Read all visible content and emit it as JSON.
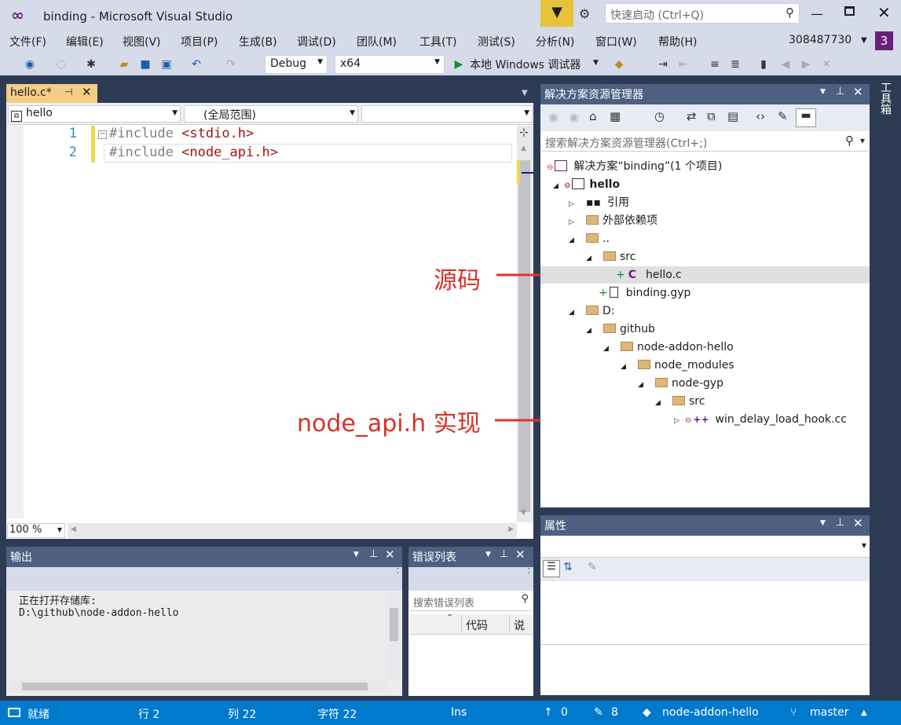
{
  "window": {
    "title": "binding - Microsoft Visual Studio",
    "quick_launch_placeholder": "快速启动 (Ctrl+Q)",
    "account": "308487730",
    "notif": "3"
  },
  "menu": [
    "文件(F)",
    "编辑(E)",
    "视图(V)",
    "项目(P)",
    "生成(B)",
    "调试(D)",
    "团队(M)",
    "工具(T)",
    "测试(S)",
    "分析(N)",
    "窗口(W)",
    "帮助(H)"
  ],
  "toolbar": {
    "config": "Debug",
    "platform": "x64",
    "run_label": "本地 Windows 调试器"
  },
  "editor": {
    "tab": "hello.c*",
    "scope_left": "hello",
    "scope_mid": "(全局范围)",
    "zoom": "100 %",
    "lines": [
      {
        "num": "1",
        "directive": "#include",
        "target": "<stdio.h>"
      },
      {
        "num": "2",
        "directive": "#include",
        "target": "<node_api.h>"
      }
    ]
  },
  "solution": {
    "title": "解决方案资源管理器",
    "search": "搜索解决方案资源管理器(Ctrl+;)",
    "solution_label": "解决方案“binding”(1 个项目)",
    "project": "hello",
    "items": {
      "refs": "引用",
      "extdeps": "外部依赖项",
      "dotdot": "..",
      "src": "src",
      "hello_c": "hello.c",
      "binding_gyp": "binding.gyp",
      "d": "D:",
      "github": "github",
      "addon": "node-addon-hello",
      "node_modules": "node_modules",
      "node_gyp": "node-gyp",
      "src2": "src",
      "hook": "win_delay_load_hook.cc"
    }
  },
  "annotations": {
    "source": "源码",
    "impl": "node_api.h 实现"
  },
  "properties": {
    "title": "属性"
  },
  "output": {
    "title": "输出",
    "line1": "正在打开存储库:",
    "line2": "D:\\github\\node-addon-hello"
  },
  "errors": {
    "title": "错误列表",
    "search": "搜索错误列表",
    "col_code": "代码",
    "col_desc": "说明"
  },
  "side_tab": "工具箱",
  "status": {
    "ready": "就绪",
    "row": "行 2",
    "col": "列 22",
    "char": "字符 22",
    "ins": "Ins",
    "up": "0",
    "pen": "8",
    "repo": "node-addon-hello",
    "branch": "master"
  },
  "colors": {
    "accent": "#007acc",
    "arrow": "#e8312a",
    "annotation": "#d93025"
  }
}
